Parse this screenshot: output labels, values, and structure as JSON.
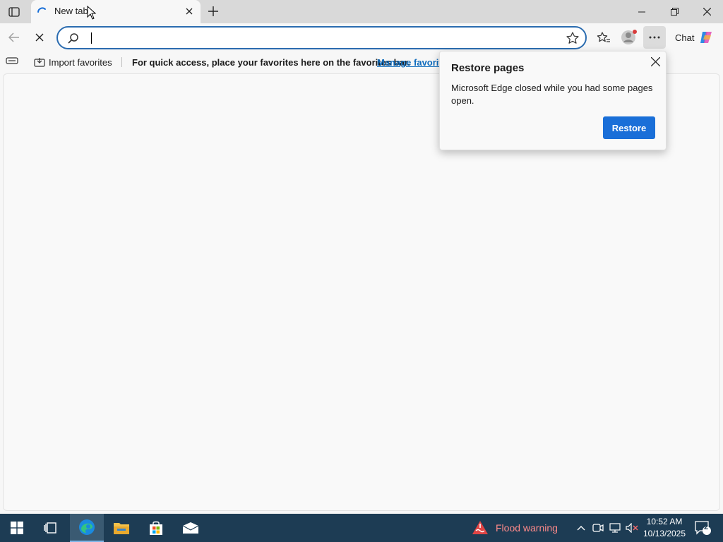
{
  "tab": {
    "title": "New tab"
  },
  "addressbar": {
    "value": "",
    "placeholder": ""
  },
  "toolbar": {
    "chat_label": "Chat"
  },
  "favbar": {
    "import_label": "Import favorites",
    "hint": "For quick access, place your favorites here on the favorites bar.",
    "manage_link": "Manage favorites"
  },
  "popup": {
    "title": "Restore pages",
    "message": "Microsoft Edge closed while you had some pages open.",
    "restore_label": "Restore"
  },
  "taskbar": {
    "weather_text": "Flood warning",
    "time": "10:52 AM",
    "date": "10/13/2025",
    "notification_count": "2"
  },
  "colors": {
    "accent": "#1a6fd8",
    "address_border": "#2b6cb0",
    "taskbar": "#1d3c54",
    "warning": "#e04545"
  },
  "icons": [
    "tab-actions-icon",
    "spinner-icon",
    "close-icon",
    "plus-icon",
    "minimize-icon",
    "restore-window-icon",
    "back-icon",
    "stop-icon",
    "search-icon",
    "star-icon",
    "favorites-icon",
    "profile-icon",
    "more-icon",
    "copilot-icon",
    "windows-start-icon",
    "task-view-icon",
    "edge-icon",
    "file-explorer-icon",
    "store-icon",
    "mail-icon",
    "flood-warning-icon",
    "chevron-up-icon",
    "meet-icon",
    "network-icon",
    "volume-muted-icon",
    "notification-icon"
  ]
}
